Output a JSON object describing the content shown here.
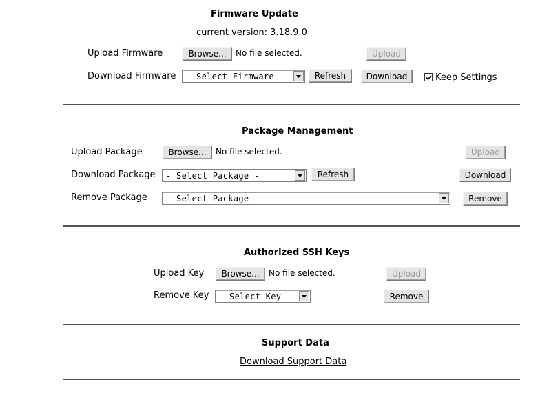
{
  "firmware": {
    "title": "Firmware Update",
    "current_version": "current version: 3.18.9.0",
    "upload_label": "Upload Firmware",
    "browse_label": "Browse...",
    "no_file": "No file selected.",
    "upload_button": "Upload",
    "download_label": "Download Firmware",
    "select_value": "- Select Firmware -",
    "refresh_button": "Refresh",
    "download_button": "Download",
    "keep_settings_label": "Keep Settings",
    "keep_settings_checked": true
  },
  "packages": {
    "title": "Package Management",
    "upload_label": "Upload Package",
    "browse_label": "Browse...",
    "no_file": "No file selected.",
    "upload_button": "Upload",
    "download_label": "Download Package",
    "download_select_value": "- Select Package -",
    "refresh_button": "Refresh",
    "download_button": "Download",
    "remove_label": "Remove Package",
    "remove_select_value": "- Select Package -",
    "remove_button": "Remove"
  },
  "ssh": {
    "title": "Authorized SSH Keys",
    "upload_label": "Upload Key",
    "browse_label": "Browse...",
    "no_file": "No file selected.",
    "upload_button": "Upload",
    "remove_label": "Remove Key",
    "select_value": "- Select Key -",
    "remove_button": "Remove"
  },
  "support": {
    "title": "Support Data",
    "download_link": "Download Support Data"
  }
}
